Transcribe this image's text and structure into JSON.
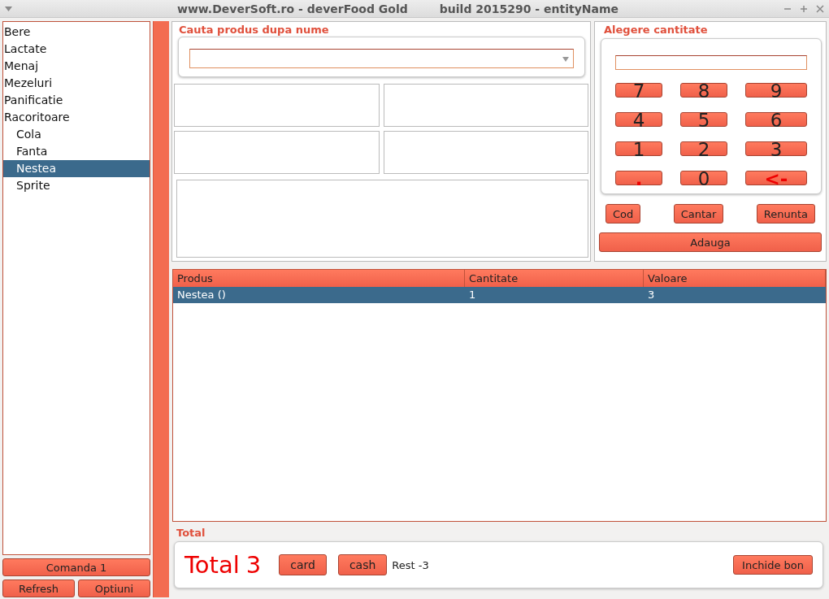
{
  "window": {
    "title": "www.DeverSoft.ro - deverFood Gold        build 2015290 - entityName"
  },
  "tree": [
    {
      "label": "Bere",
      "selected": false
    },
    {
      "label": "Lactate",
      "selected": false
    },
    {
      "label": "Menaj",
      "selected": false
    },
    {
      "label": "Mezeluri",
      "selected": false
    },
    {
      "label": "Panificatie",
      "selected": false
    },
    {
      "label": "Racoritoare",
      "selected": false,
      "children": [
        {
          "label": "Cola",
          "selected": false
        },
        {
          "label": "Fanta",
          "selected": false
        },
        {
          "label": "Nestea",
          "selected": true
        },
        {
          "label": "Sprite",
          "selected": false
        }
      ]
    }
  ],
  "left_buttons": {
    "order": "Comanda 1",
    "refresh": "Refresh",
    "options": "Optiuni"
  },
  "search": {
    "title": "Cauta produs dupa nume"
  },
  "quantity": {
    "title": "Alegere cantitate",
    "keys": [
      {
        "label": "7",
        "kind": "digit"
      },
      {
        "label": "8",
        "kind": "digit"
      },
      {
        "label": "9",
        "kind": "digit"
      },
      {
        "label": "4",
        "kind": "digit"
      },
      {
        "label": "5",
        "kind": "digit"
      },
      {
        "label": "6",
        "kind": "digit"
      },
      {
        "label": "1",
        "kind": "digit"
      },
      {
        "label": "2",
        "kind": "digit"
      },
      {
        "label": "3",
        "kind": "digit"
      },
      {
        "label": ".",
        "kind": "special"
      },
      {
        "label": "0",
        "kind": "digit"
      },
      {
        "label": "<-",
        "kind": "special"
      }
    ],
    "actions": [
      "Cod",
      "Cantar",
      "Renunta"
    ],
    "add": "Adauga"
  },
  "table": {
    "columns": [
      "Produs",
      "Cantitate",
      "Valoare"
    ],
    "rows": [
      {
        "cells": [
          "Nestea ()",
          "1",
          "3"
        ],
        "selected": true
      }
    ]
  },
  "total": {
    "title": "Total",
    "label": "Total",
    "value": "3",
    "pay_buttons": [
      "card",
      "cash"
    ],
    "rest": "Rest -3",
    "close": "Inchide bon"
  }
}
